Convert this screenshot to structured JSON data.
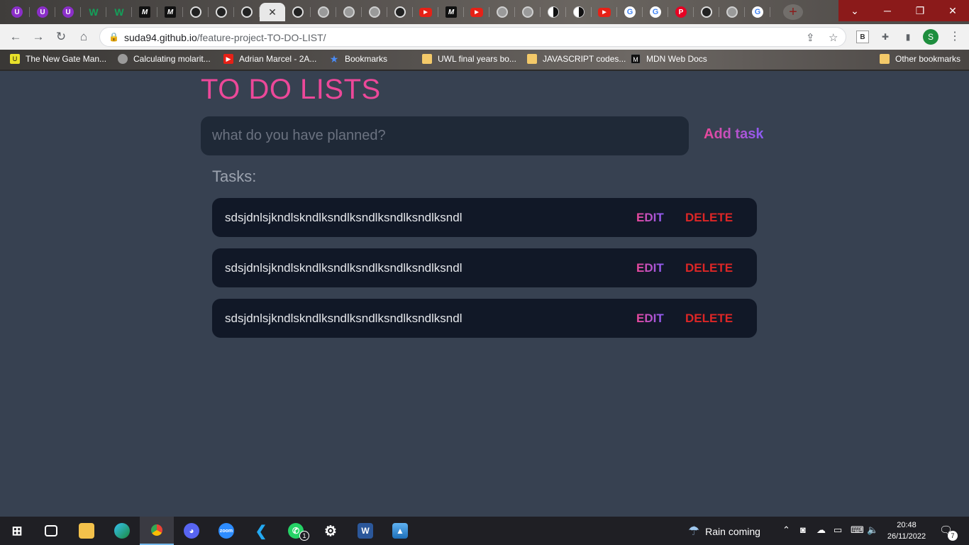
{
  "browser": {
    "tabs": [
      {
        "icon": "u-icon",
        "glyph": "U"
      },
      {
        "icon": "u-icon",
        "glyph": "U"
      },
      {
        "icon": "u-icon",
        "glyph": "U"
      },
      {
        "icon": "w-icon",
        "glyph": "W"
      },
      {
        "icon": "w-icon",
        "glyph": "W"
      },
      {
        "icon": "m-icon",
        "glyph": "M"
      },
      {
        "icon": "m-icon",
        "glyph": "M"
      },
      {
        "icon": "github-icon",
        "glyph": ""
      },
      {
        "icon": "github-icon",
        "glyph": ""
      },
      {
        "icon": "github-icon",
        "glyph": ""
      },
      {
        "icon": "close-icon",
        "glyph": "✕",
        "active": true
      },
      {
        "icon": "github-icon",
        "glyph": ""
      },
      {
        "icon": "globe-icon",
        "glyph": ""
      },
      {
        "icon": "globe-icon",
        "glyph": ""
      },
      {
        "icon": "globe-icon",
        "glyph": ""
      },
      {
        "icon": "github-icon",
        "glyph": ""
      },
      {
        "icon": "youtube-icon",
        "glyph": "▶"
      },
      {
        "icon": "m-icon",
        "glyph": "M"
      },
      {
        "icon": "youtube-icon",
        "glyph": "▶"
      },
      {
        "icon": "globe-icon",
        "glyph": ""
      },
      {
        "icon": "globe-icon",
        "glyph": ""
      },
      {
        "icon": "half-circle-icon",
        "glyph": ""
      },
      {
        "icon": "half-circle-icon",
        "glyph": ""
      },
      {
        "icon": "youtube-icon",
        "glyph": "▶"
      },
      {
        "icon": "google-icon",
        "glyph": "G"
      },
      {
        "icon": "google-icon",
        "glyph": "G"
      },
      {
        "icon": "pinterest-icon",
        "glyph": "P"
      },
      {
        "icon": "github-icon",
        "glyph": ""
      },
      {
        "icon": "globe-icon",
        "glyph": ""
      },
      {
        "icon": "google-icon",
        "glyph": "G"
      }
    ],
    "url_host": "suda94.github.io",
    "url_path": "/feature-project-TO-DO-LIST/",
    "profile_initial": "S",
    "extension_label": "B",
    "bookmarks": [
      {
        "label": "The New Gate Man...",
        "icon": "ng"
      },
      {
        "label": "Calculating molarit...",
        "icon": "globe"
      },
      {
        "label": "Adrian Marcel - 2A...",
        "icon": "yt"
      },
      {
        "label": "Bookmarks",
        "icon": "star"
      },
      {
        "label": "UWL final years bo...",
        "icon": "folder"
      },
      {
        "label": "JAVASCRIPT codes...",
        "icon": "folder"
      },
      {
        "label": "MDN Web Docs",
        "icon": "mdn"
      }
    ],
    "other_bookmarks": "Other bookmarks"
  },
  "app": {
    "title": "TO DO LISTS",
    "input_placeholder": "what do you have planned?",
    "add_button": "Add task",
    "tasks_heading": "Tasks:",
    "edit_label": "EDIT",
    "delete_label": "DELETE",
    "tasks": [
      {
        "text": "sdsjdnlsjkndlskndlksndlksndlksndlksndlksndl"
      },
      {
        "text": "sdsjdnlsjkndlskndlksndlksndlksndlksndlksndl"
      },
      {
        "text": "sdsjdnlsjkndlskndlksndlksndlksndlksndlksndl"
      }
    ],
    "colors": {
      "accent_pink": "#ec4899",
      "accent_purple": "#8b5cf6",
      "delete_red": "#dc2626",
      "background": "#374151",
      "card": "#111827"
    }
  },
  "taskbar": {
    "weather": "Rain coming",
    "time": "20:48",
    "date": "26/11/2022",
    "whatsapp_badge": "1",
    "notification_count": "7"
  }
}
